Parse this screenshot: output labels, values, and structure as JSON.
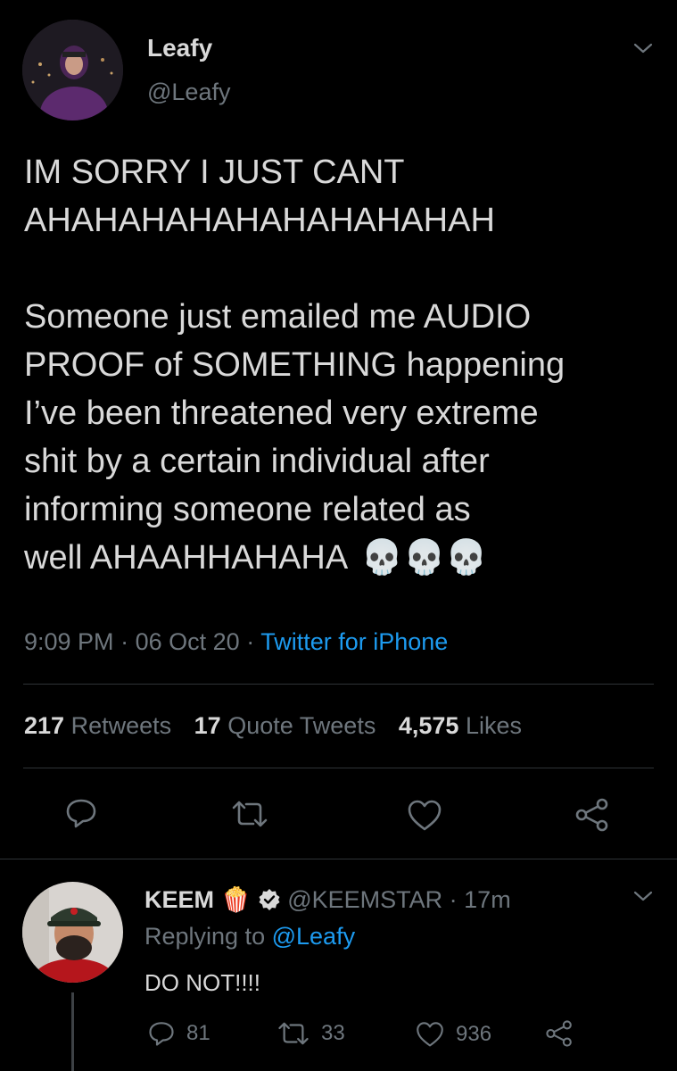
{
  "tweet": {
    "author_name": "Leafy",
    "author_handle": "@Leafy",
    "text_lines": [
      "IM SORRY I JUST CANT",
      "AHAHAHAHAHAHAHAHAHAH",
      "",
      "Someone just emailed me AUDIO",
      "PROOF of SOMETHING happening",
      "I’ve been threatened very extreme",
      "shit by a certain individual after",
      "informing someone related as",
      "well AHAAHHAHAHA"
    ],
    "emoji": "💀💀💀",
    "time": "9:09 PM",
    "sep": "·",
    "date": "06 Oct 20",
    "source": "Twitter for iPhone",
    "stats": {
      "retweets_count": "217",
      "retweets_label": "Retweets",
      "quotes_count": "17",
      "quotes_label": "Quote Tweets",
      "likes_count": "4,575",
      "likes_label": "Likes"
    }
  },
  "reply": {
    "author_name": "KEEM",
    "author_emoji": "🍿",
    "author_handle": "@KEEMSTAR",
    "sep": "·",
    "age": "17m",
    "replying_prefix": "Replying to",
    "replying_handle": "@Leafy",
    "text": "DO NOT!!!!",
    "replies_count": "81",
    "retweets_count": "33",
    "likes_count": "936"
  },
  "colors": {
    "background": "#000000",
    "text": "#d9d9d9",
    "muted": "#6e767d",
    "accent": "#1d9bf0",
    "divider": "#2f3336"
  }
}
